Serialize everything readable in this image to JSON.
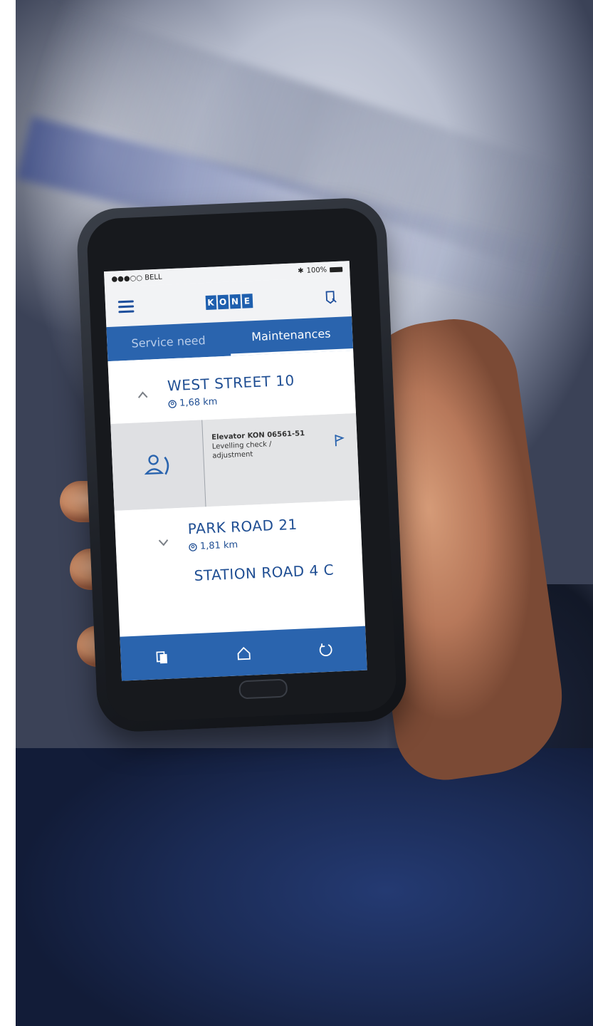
{
  "status_bar": {
    "carrier": "●●●○○ BELL",
    "battery": "100%"
  },
  "header": {
    "logo_letters": [
      "K",
      "O",
      "N",
      "E"
    ]
  },
  "tabs": [
    {
      "label": "Service need",
      "active": false
    },
    {
      "label": "Maintenances",
      "active": true
    }
  ],
  "locations": [
    {
      "title": "WEST STREET 10",
      "distance": "1,68 km",
      "expanded": true
    },
    {
      "title": "PARK ROAD 21",
      "distance": "1,81 km",
      "expanded": false
    },
    {
      "title": "STATION ROAD 4 C"
    }
  ],
  "equipment": {
    "id": "Elevator KON 06561-51",
    "task": "Levelling check / adjustment"
  },
  "bottom_nav": {
    "icons": [
      "documents-icon",
      "home-icon",
      "refresh-icon"
    ]
  },
  "colors": {
    "brand_blue": "#2a64ae",
    "text_blue": "#1f4e93"
  }
}
